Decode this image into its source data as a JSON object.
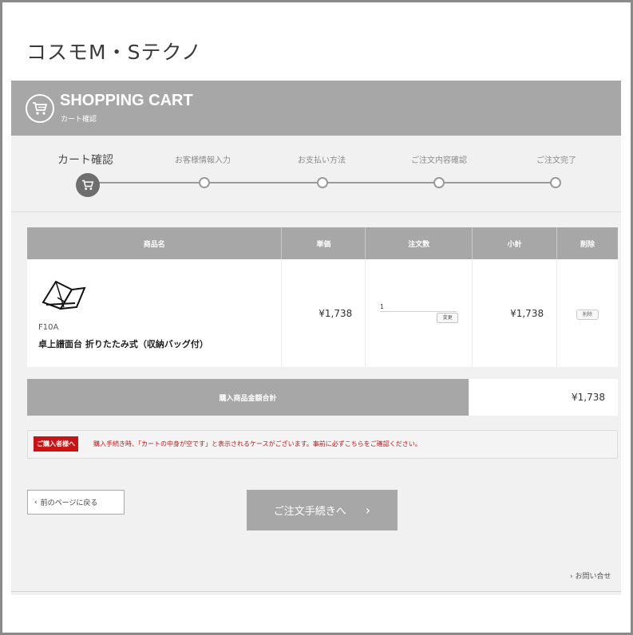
{
  "store": {
    "title": "コスモM・Sテクノ"
  },
  "cart_header": {
    "title": "SHOPPING CART",
    "subtitle": "カート確認",
    "icon": "shopping-cart-icon"
  },
  "steps": [
    {
      "label": "カート確認",
      "active": true
    },
    {
      "label": "お客様情報入力",
      "active": false
    },
    {
      "label": "お支払い方法",
      "active": false
    },
    {
      "label": "ご注文内容確認",
      "active": false
    },
    {
      "label": "ご注文完了",
      "active": false
    }
  ],
  "table": {
    "headers": {
      "product": "商品名",
      "unit_price": "単価",
      "qty": "注文数",
      "subtotal": "小計",
      "delete": "削除"
    },
    "row": {
      "code": "F10A",
      "name": "卓上譜面台 折りたたみ式（収納バッグ付）",
      "unit_price": "¥1,738",
      "qty": "1",
      "qty_button": "変更",
      "subtotal": "¥1,738",
      "delete_button": "削除",
      "image_icon": "music-stand-icon"
    }
  },
  "total": {
    "label": "購入商品金額合計",
    "value": "¥1,738"
  },
  "notice": {
    "badge": "ご購入者様へ",
    "text": "購入手続き時、「カートの中身が空です」と表示されるケースがございます。事前に必ずこちらをご確認ください。"
  },
  "buttons": {
    "back": "前のページに戻る",
    "checkout": "ご注文手続きへ"
  },
  "footer": {
    "contact": "お問い合せ"
  },
  "colors": {
    "header_gray": "#a7a7a7",
    "notice_red": "#c81414",
    "background": "#f1f1f1"
  }
}
